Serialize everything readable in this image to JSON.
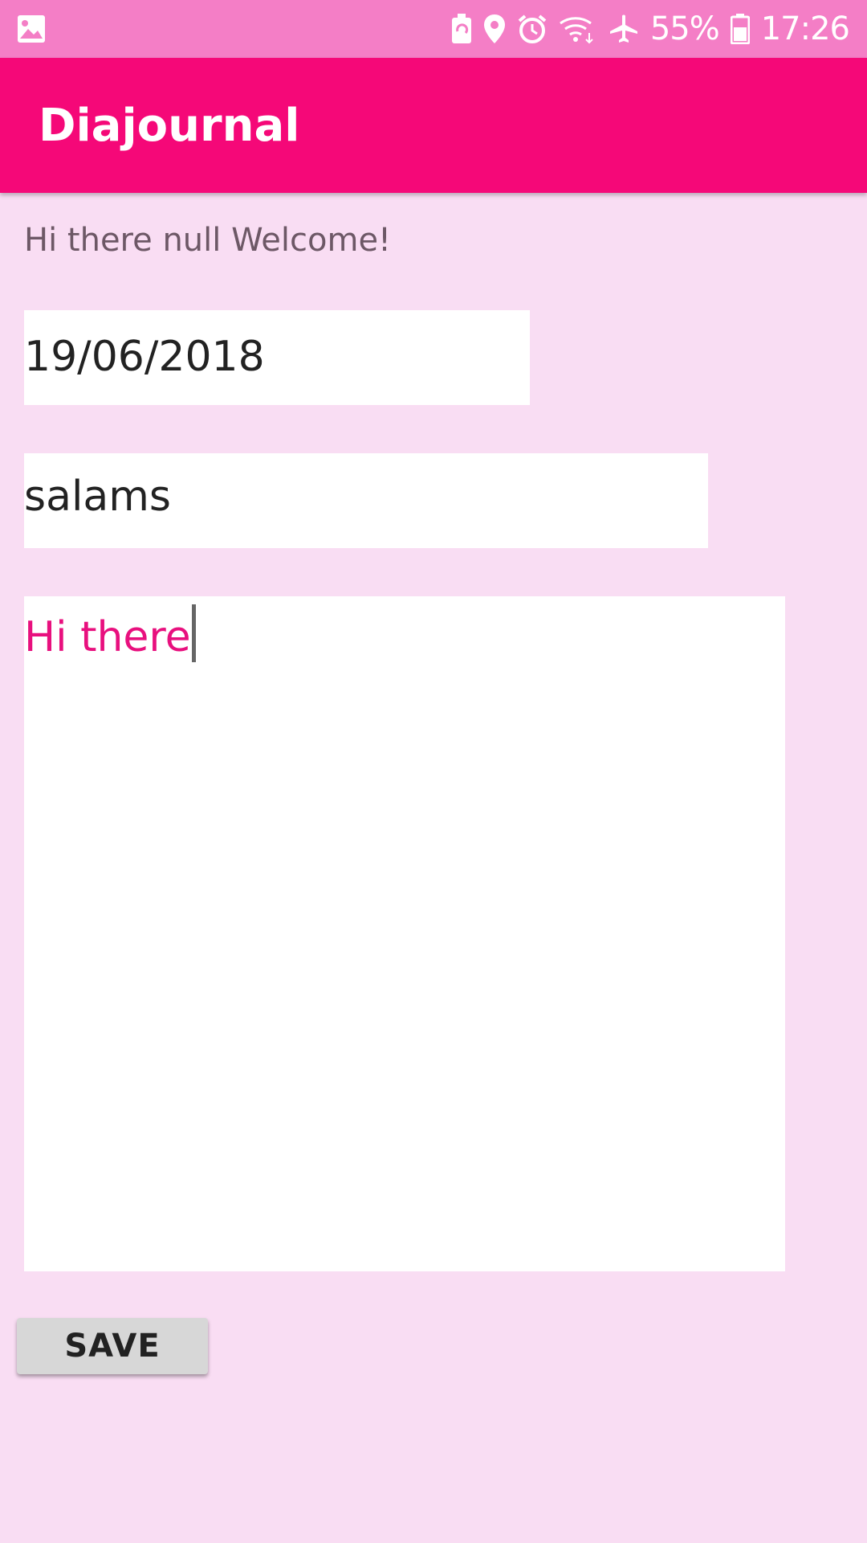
{
  "status_bar": {
    "battery_percent": "55%",
    "time": "17:26",
    "icons": [
      "image-icon",
      "battery-saver-icon",
      "location-icon",
      "alarm-icon",
      "wifi-icon",
      "airplane-icon",
      "battery-icon"
    ]
  },
  "app_bar": {
    "title": "Diajournal"
  },
  "welcome_text": "Hi there null Welcome!",
  "form": {
    "date_value": "19/06/2018",
    "title_value": "salams",
    "body_value": "Hi there"
  },
  "actions": {
    "save_label": "SAVE"
  },
  "colors": {
    "status_bar": "#f47ec6",
    "app_bar": "#f50878",
    "background": "#f9ddf3",
    "body_text": "#e8107e"
  }
}
